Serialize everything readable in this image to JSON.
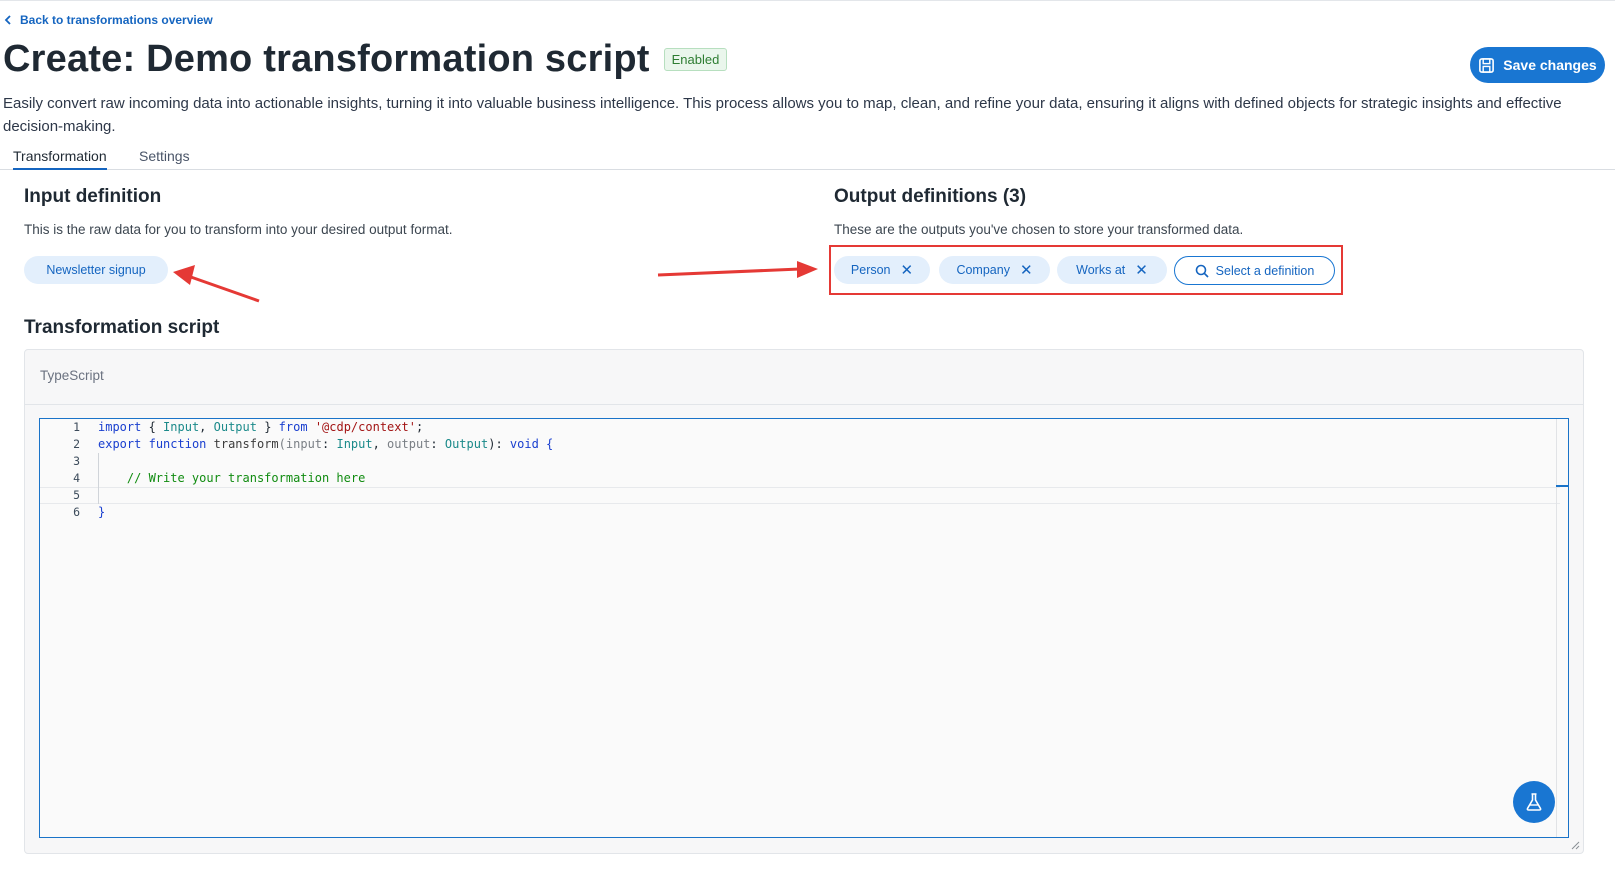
{
  "nav": {
    "back_label": "Back to transformations overview"
  },
  "header": {
    "title": "Create: Demo transformation script",
    "status_badge": "Enabled",
    "save_label": "Save changes",
    "description": "Easily convert raw incoming data into actionable insights, turning it into valuable business intelligence. This process allows you to map, clean, and refine your data, ensuring it aligns with defined objects for strategic insights and effective decision-making."
  },
  "tabs": [
    {
      "label": "Transformation",
      "active": true
    },
    {
      "label": "Settings",
      "active": false
    }
  ],
  "input_definition": {
    "title": "Input definition",
    "description": "This is the raw data for you to transform into your desired output format.",
    "chip": "Newsletter signup"
  },
  "output_definitions": {
    "title": "Output definitions (3)",
    "description": "These are the outputs you've chosen to store your transformed data.",
    "chips": [
      "Person",
      "Company",
      "Works at"
    ],
    "remove_glyph": "✕",
    "select_label": "Select a definition"
  },
  "script": {
    "title": "Transformation script",
    "language": "TypeScript",
    "line_numbers": [
      "1",
      "2",
      "3",
      "4",
      "5",
      "6"
    ],
    "code": {
      "l1": {
        "kw1": "import",
        "p1": " { ",
        "t1": "Input",
        "p2": ", ",
        "t2": "Output",
        "p3": " } ",
        "kw2": "from",
        "p4": " ",
        "s1": "'@cdp/context'",
        "p5": ";"
      },
      "l2": {
        "kw1": "export",
        "p1": " ",
        "kw2": "function",
        "p2": " ",
        "fn": "transform",
        "p3": "(",
        "a1": "input",
        "p4": ": ",
        "t1": "Input",
        "p5": ", ",
        "a2": "output",
        "p6": ": ",
        "t2": "Output",
        "p7": "): ",
        "kw3": "void",
        "p8": " {"
      },
      "l4": {
        "pad": "    ",
        "c": "// Write your transformation here"
      },
      "l6": {
        "p": "}"
      }
    }
  },
  "icons": {
    "back": "chevron-left-icon",
    "save": "save-icon",
    "search": "search-icon",
    "remove": "close-icon",
    "flask": "flask-icon"
  },
  "colors": {
    "accent": "#1976d2",
    "chip_bg": "#e3effc",
    "badge_green": "#2e7d32",
    "annotation_red": "#e53935"
  }
}
